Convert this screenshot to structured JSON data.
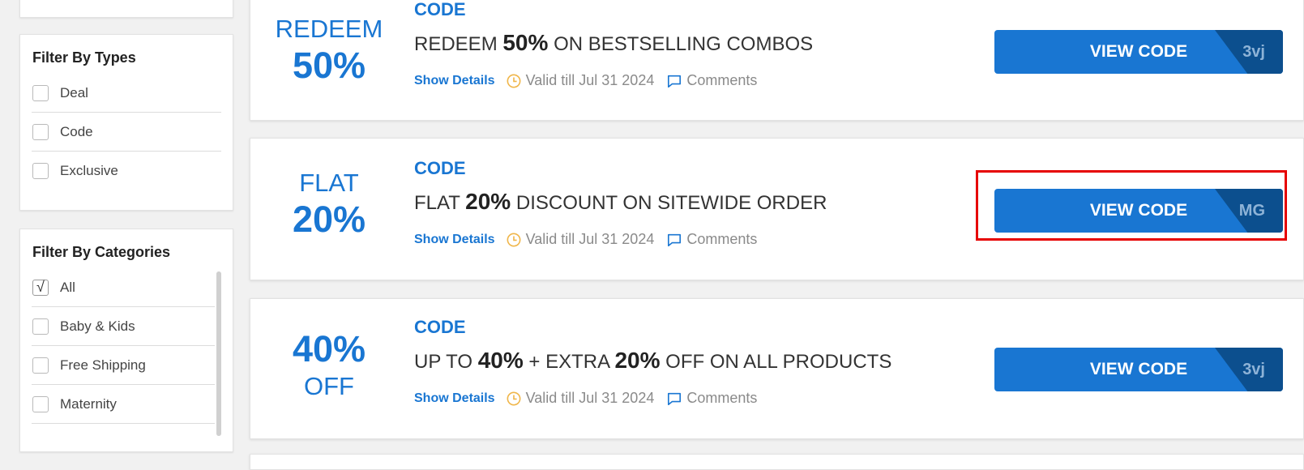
{
  "filters": {
    "types": {
      "title": "Filter By Types",
      "items": [
        {
          "label": "Deal",
          "checked": false
        },
        {
          "label": "Code",
          "checked": false
        },
        {
          "label": "Exclusive",
          "checked": false
        }
      ]
    },
    "categories": {
      "title": "Filter By Categories",
      "items": [
        {
          "label": "All",
          "checked": true,
          "mark": "√"
        },
        {
          "label": "Baby & Kids",
          "checked": false
        },
        {
          "label": "Free Shipping",
          "checked": false
        },
        {
          "label": "Maternity",
          "checked": false
        }
      ]
    }
  },
  "coupons": [
    {
      "badge_line1": "REDEEM",
      "badge_line2": "50%",
      "type": "CODE",
      "title_pre": "REDEEM ",
      "title_bold": "50%",
      "title_post": " ON BESTSELLING COMBOS",
      "show_details": "Show Details",
      "valid": "Valid till Jul 31 2024",
      "comments": "Comments",
      "button": "VIEW CODE",
      "code_peek": "3vj"
    },
    {
      "badge_line1": "FLAT",
      "badge_line2": "20%",
      "type": "CODE",
      "title_pre": "FLAT ",
      "title_bold": "20%",
      "title_post": " DISCOUNT ON SITEWIDE ORDER",
      "show_details": "Show Details",
      "valid": "Valid till Jul 31 2024",
      "comments": "Comments",
      "button": "VIEW CODE",
      "code_peek": "MG"
    },
    {
      "badge_line1": "40%",
      "badge_line2": "OFF",
      "type": "CODE",
      "title_pre": "UP TO ",
      "title_bold": "40%",
      "title_mid": " + EXTRA ",
      "title_bold2": "20%",
      "title_post": " OFF ON ALL PRODUCTS",
      "show_details": "Show Details",
      "valid": "Valid till Jul 31 2024",
      "comments": "Comments",
      "button": "VIEW CODE",
      "code_peek": "3vj"
    }
  ],
  "colors": {
    "accent": "#1976d2",
    "button_dark": "#0c4f8e",
    "highlight": "#e60000"
  }
}
